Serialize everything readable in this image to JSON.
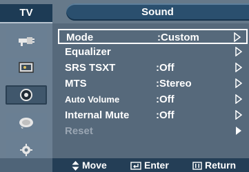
{
  "tv_tab": "TV",
  "title": "Sound",
  "sidebar": [
    {
      "icon": "input-plug-icon",
      "active": false
    },
    {
      "icon": "picture-icon",
      "active": false
    },
    {
      "icon": "sound-speaker-icon",
      "active": true
    },
    {
      "icon": "channel-dish-icon",
      "active": false
    },
    {
      "icon": "setup-gear-icon",
      "active": false
    }
  ],
  "menu": [
    {
      "label": "Mode",
      "value": ":Custom",
      "arrow": "outline",
      "selected": true,
      "small": false,
      "enabled": true
    },
    {
      "label": "Equalizer",
      "value": "",
      "arrow": "outline",
      "selected": false,
      "small": false,
      "enabled": true
    },
    {
      "label": "SRS TSXT",
      "value": ":Off",
      "arrow": "outline",
      "selected": false,
      "small": false,
      "enabled": true
    },
    {
      "label": "MTS",
      "value": ":Stereo",
      "arrow": "outline",
      "selected": false,
      "small": false,
      "enabled": true
    },
    {
      "label": "Auto Volume",
      "value": ":Off",
      "arrow": "outline",
      "selected": false,
      "small": true,
      "enabled": true
    },
    {
      "label": "Internal Mute",
      "value": ":Off",
      "arrow": "outline",
      "selected": false,
      "small": false,
      "enabled": true
    },
    {
      "label": "Reset",
      "value": "",
      "arrow": "filled",
      "selected": false,
      "small": false,
      "enabled": false
    }
  ],
  "footer": {
    "move": "Move",
    "enter": "Enter",
    "return": "Return"
  }
}
